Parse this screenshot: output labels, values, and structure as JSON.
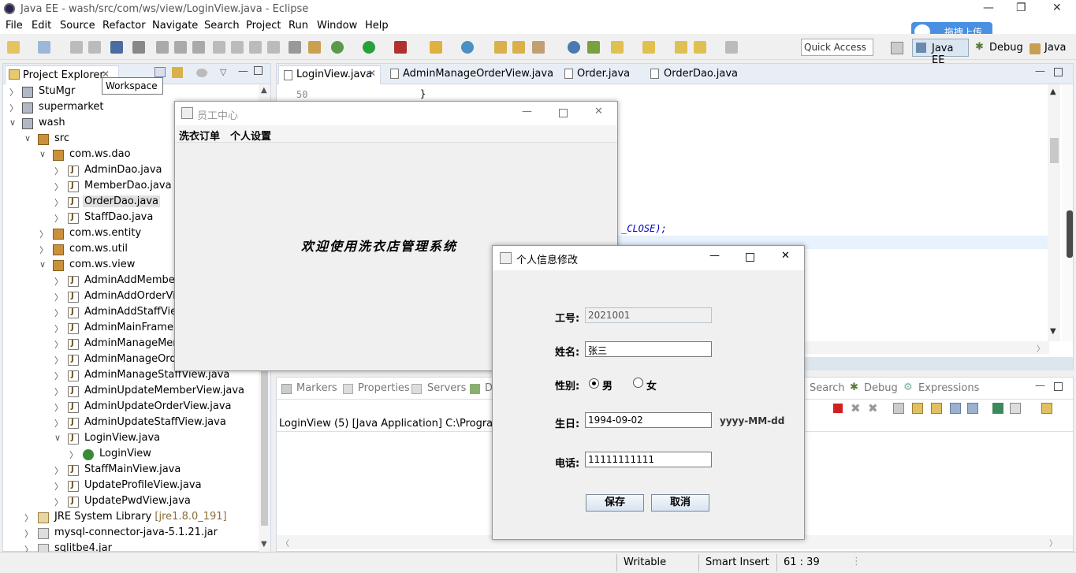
{
  "window": {
    "title": "Java EE - wash/src/com/ws/view/LoginView.java - Eclipse"
  },
  "menu": [
    "File",
    "Edit",
    "Source",
    "Refactor",
    "Navigate",
    "Search",
    "Project",
    "Run",
    "Window",
    "Help"
  ],
  "toolbar": {
    "quick_access": "Quick Access",
    "upload_label": "拖拽上传"
  },
  "perspectives": [
    "Java EE",
    "Debug",
    "Java"
  ],
  "explorer": {
    "tab_label": "Project Explorer",
    "tooltip": "Workspace",
    "items": [
      {
        "label": "StuMgr",
        "suffix": ""
      },
      {
        "label": "supermarket",
        "suffix": ""
      },
      {
        "label": "wash",
        "suffix": ""
      },
      {
        "label": "src",
        "suffix": ""
      },
      {
        "label": "com.ws.dao",
        "suffix": ""
      },
      {
        "label": "AdminDao.java",
        "suffix": ""
      },
      {
        "label": "MemberDao.java",
        "suffix": ""
      },
      {
        "label": "OrderDao.java",
        "suffix": ""
      },
      {
        "label": "StaffDao.java",
        "suffix": ""
      },
      {
        "label": "com.ws.entity",
        "suffix": ""
      },
      {
        "label": "com.ws.util",
        "suffix": ""
      },
      {
        "label": "com.ws.view",
        "suffix": ""
      },
      {
        "label": "AdminAddMemberView.java",
        "suffix": ""
      },
      {
        "label": "AdminAddOrderView.java",
        "suffix": ""
      },
      {
        "label": "AdminAddStaffView.java",
        "suffix": ""
      },
      {
        "label": "AdminMainFrame.java",
        "suffix": ""
      },
      {
        "label": "AdminManageMemberView.java",
        "suffix": ""
      },
      {
        "label": "AdminManageOrderView.java",
        "suffix": ""
      },
      {
        "label": "AdminManageStaffView.java",
        "suffix": ""
      },
      {
        "label": "AdminUpdateMemberView.java",
        "suffix": ""
      },
      {
        "label": "AdminUpdateOrderView.java",
        "suffix": ""
      },
      {
        "label": "AdminUpdateStaffView.java",
        "suffix": ""
      },
      {
        "label": "LoginView.java",
        "suffix": ""
      },
      {
        "label": "LoginView",
        "suffix": ""
      },
      {
        "label": "StaffMainView.java",
        "suffix": ""
      },
      {
        "label": "UpdateProfileView.java",
        "suffix": ""
      },
      {
        "label": "UpdatePwdView.java",
        "suffix": ""
      },
      {
        "label": "JRE System Library",
        "suffix": "[jre1.8.0_191]"
      },
      {
        "label": "mysql-connector-java-5.1.21.jar",
        "suffix": ""
      },
      {
        "label": "sqlitbe4.jar",
        "suffix": ""
      }
    ]
  },
  "editor": {
    "tabs": [
      "LoginView.java",
      "AdminManageOrderView.java",
      "Order.java",
      "OrderDao.java"
    ],
    "line_number": "50",
    "line_text": "}",
    "code_fragment": "_CLOSE);"
  },
  "console": {
    "tabs": [
      "Markers",
      "Properties",
      "Servers",
      "D"
    ],
    "right_tabs": [
      "Search",
      "Debug",
      "Expressions"
    ],
    "launch_text": "LoginView (5) [Java Application] C:\\Program Fil"
  },
  "status": {
    "writable": "Writable",
    "insert": "Smart Insert",
    "position": "61 : 39"
  },
  "staff_window": {
    "title": "员工中心",
    "menu": [
      "洗衣订单",
      "个人设置"
    ],
    "welcome": "欢迎使用洗衣店管理系统"
  },
  "profile_dialog": {
    "title": "个人信息修改",
    "id_label": "工号:",
    "id_value": "2021001",
    "name_label": "姓名:",
    "name_value": "张三",
    "gender_label": "性别:",
    "gender_male": "男",
    "gender_female": "女",
    "birthday_label": "生日:",
    "birthday_value": "1994-09-02",
    "birthday_hint": "yyyy-MM-dd",
    "phone_label": "电话:",
    "phone_value": "11111111111",
    "save_label": "保存",
    "cancel_label": "取消"
  }
}
